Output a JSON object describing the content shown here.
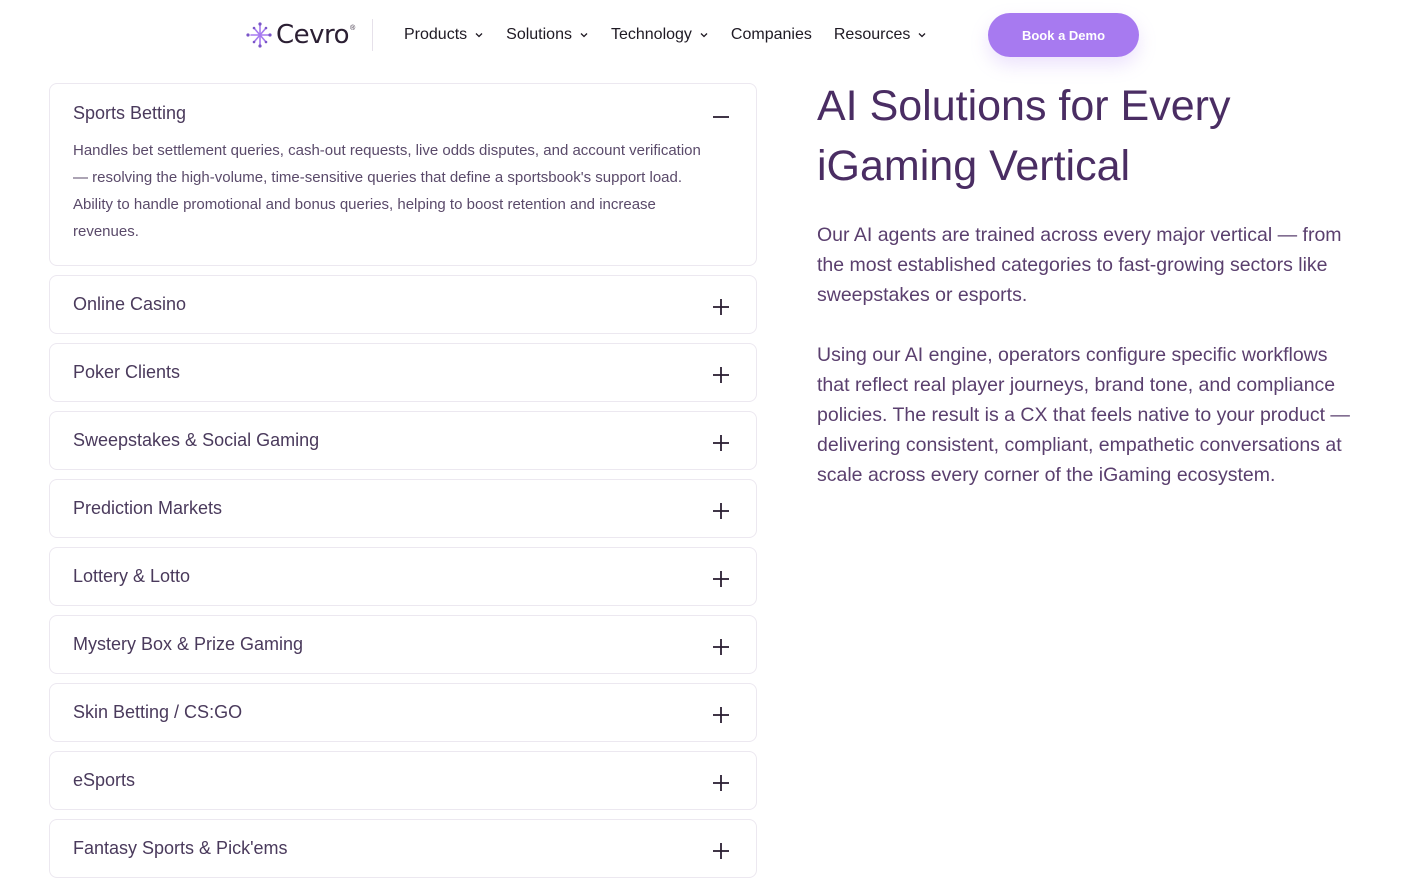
{
  "nav": {
    "logo_text": "Cevro",
    "logo_tm": "®",
    "links": [
      {
        "label": "Products",
        "has_dropdown": true
      },
      {
        "label": "Solutions",
        "has_dropdown": true
      },
      {
        "label": "Technology",
        "has_dropdown": true
      },
      {
        "label": "Companies",
        "has_dropdown": false
      },
      {
        "label": "Resources",
        "has_dropdown": true
      }
    ],
    "cta_label": "Book a Demo"
  },
  "accordion": {
    "items": [
      {
        "title": "Sports Betting",
        "open": true,
        "icon": "minus-icon",
        "body": "Handles bet settlement queries, cash-out requests, live odds disputes, and account verification — resolving the high-volume, time-sensitive queries that define a sportsbook's support load. Ability to handle promotional and bonus queries, helping to boost retention and increase revenues."
      },
      {
        "title": "Online Casino",
        "open": false,
        "icon": "plus-icon"
      },
      {
        "title": "Poker Clients",
        "open": false,
        "icon": "plus-icon"
      },
      {
        "title": "Sweepstakes & Social Gaming",
        "open": false,
        "icon": "plus-icon"
      },
      {
        "title": "Prediction Markets",
        "open": false,
        "icon": "plus-icon"
      },
      {
        "title": "Lottery & Lotto",
        "open": false,
        "icon": "plus-icon"
      },
      {
        "title": "Mystery Box & Prize Gaming",
        "open": false,
        "icon": "plus-icon"
      },
      {
        "title": "Skin Betting / CS:GO",
        "open": false,
        "icon": "plus-icon"
      },
      {
        "title": "eSports",
        "open": false,
        "icon": "plus-icon"
      },
      {
        "title": "Fantasy Sports & Pick'ems",
        "open": false,
        "icon": "plus-icon"
      }
    ]
  },
  "main": {
    "heading_line1": "AI Solutions for Every",
    "heading_line2": "iGaming Vertical",
    "paragraph1": "Our AI agents are trained across every major vertical — from the most established categories to fast-growing sectors like sweepstakes or esports.",
    "paragraph2": "Using our AI engine, operators configure specific workflows that reflect real player journeys, brand tone, and compliance policies. The result is a CX that feels native to your product — delivering consistent, compliant, empathetic conversations at scale across every corner of the iGaming ecosystem."
  },
  "colors": {
    "accent": "#a77af0",
    "heading": "#4a2d63",
    "text": "#5a3f6e",
    "border": "#ece8f0"
  }
}
